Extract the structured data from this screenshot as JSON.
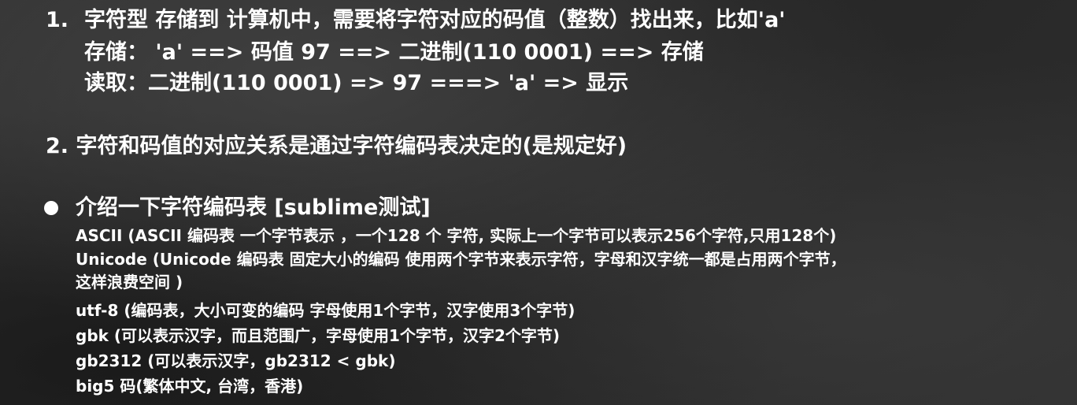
{
  "point1": {
    "number": "1.",
    "line1": "字符型 存储到 计算机中，需要将字符对应的码值（整数）找出来，比如'a'",
    "line2": "存储： 'a' ==> 码值 97 ==> 二进制(110 0001) ==> 存储",
    "line3": "读取：二进制(110 0001) => 97 ===> 'a' => 显示"
  },
  "point2": {
    "text": "2. 字符和码值的对应关系是通过字符编码表决定的(是规定好)"
  },
  "bullet": {
    "heading": "介绍一下字符编码表 [sublime测试]",
    "items": [
      "ASCII (ASCII 编码表 一个字节表示 ，一个128 个 字符, 实际上一个字节可以表示256个字符,只用128个)",
      "Unicode (Unicode 编码表 固定大小的编码 使用两个字节来表示字符，字母和汉字统一都是占用两个字节，",
      "这样浪费空间 )",
      "utf-8 (编码表，大小可变的编码 字母使用1个字节，汉字使用3个字节)",
      "gbk (可以表示汉字，而且范围广，字母使用1个字节，汉字2个字节)",
      "gb2312 (可以表示汉字，gb2312 < gbk)",
      "big5 码(繁体中文, 台湾，香港)"
    ]
  }
}
